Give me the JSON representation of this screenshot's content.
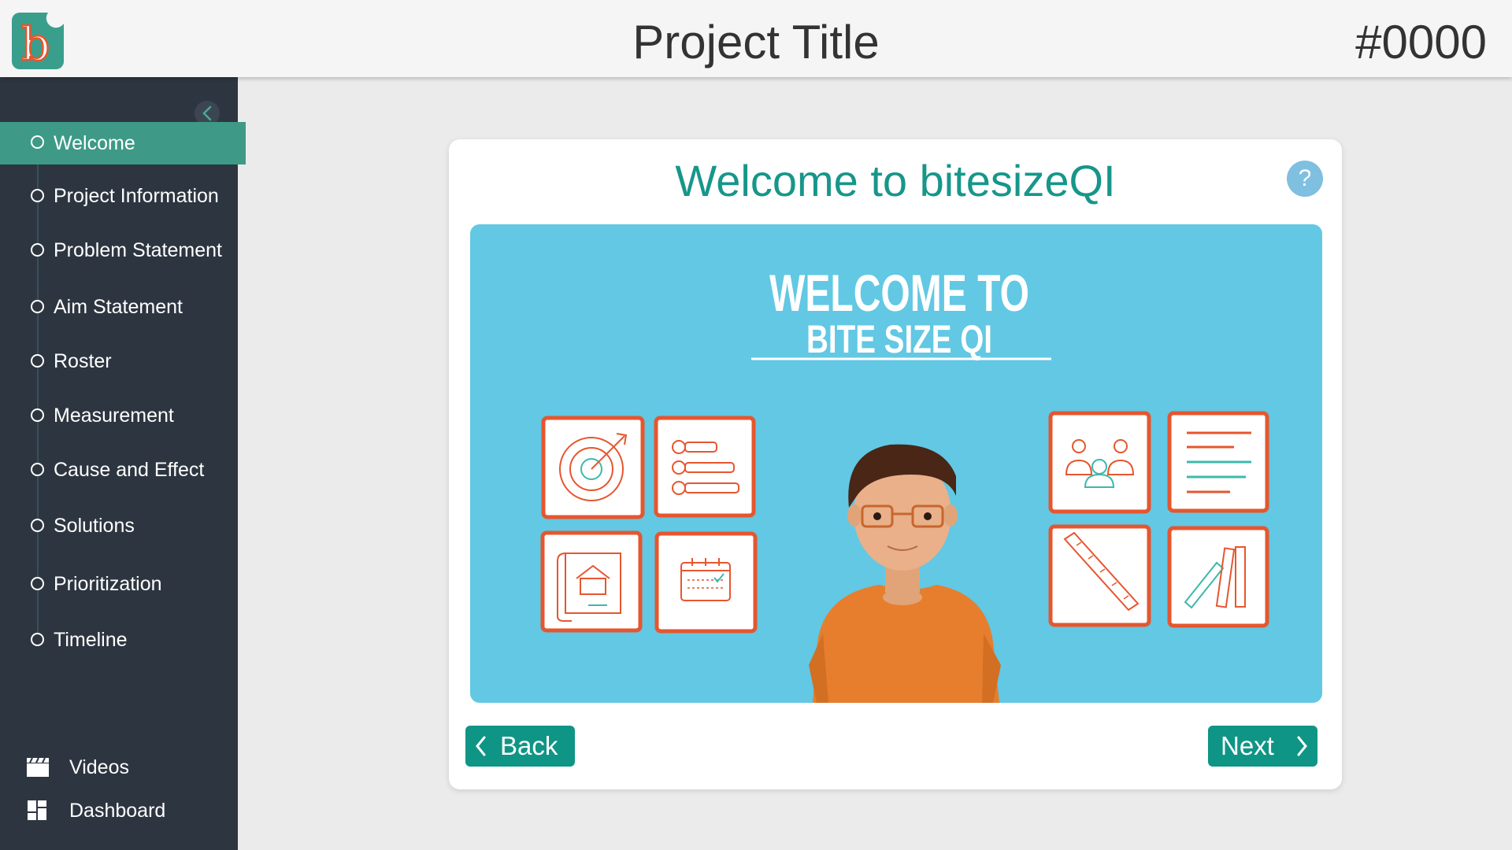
{
  "header": {
    "logo_letter": "b",
    "project_title": "Project Title",
    "project_id": "#0000"
  },
  "sidebar": {
    "nav_items": [
      {
        "label": "Welcome",
        "active": true
      },
      {
        "label": "Project Information",
        "active": false
      },
      {
        "label": "Problem Statement",
        "active": false
      },
      {
        "label": "Aim Statement",
        "active": false
      },
      {
        "label": "Roster",
        "active": false
      },
      {
        "label": "Measurement",
        "active": false
      },
      {
        "label": "Cause and Effect",
        "active": false
      },
      {
        "label": "Solutions",
        "active": false
      },
      {
        "label": "Prioritization",
        "active": false
      },
      {
        "label": "Timeline",
        "active": false
      }
    ],
    "bottom_items": [
      {
        "label": "Videos",
        "icon": "clapperboard-icon"
      },
      {
        "label": "Dashboard",
        "icon": "dashboard-icon"
      }
    ]
  },
  "card": {
    "title": "Welcome to bitesizeQI",
    "help_symbol": "?",
    "banner": {
      "line1": "WELCOME TO",
      "line2": "BITE SIZE QI"
    },
    "back_label": "Back",
    "next_label": "Next"
  },
  "colors": {
    "accent": "#0f9585",
    "sidebar_bg": "#2d3640",
    "active_item": "#3e9a86",
    "banner_bg": "#62c8e3",
    "tile_border": "#e6562e",
    "character_shirt": "#e67e2e"
  }
}
